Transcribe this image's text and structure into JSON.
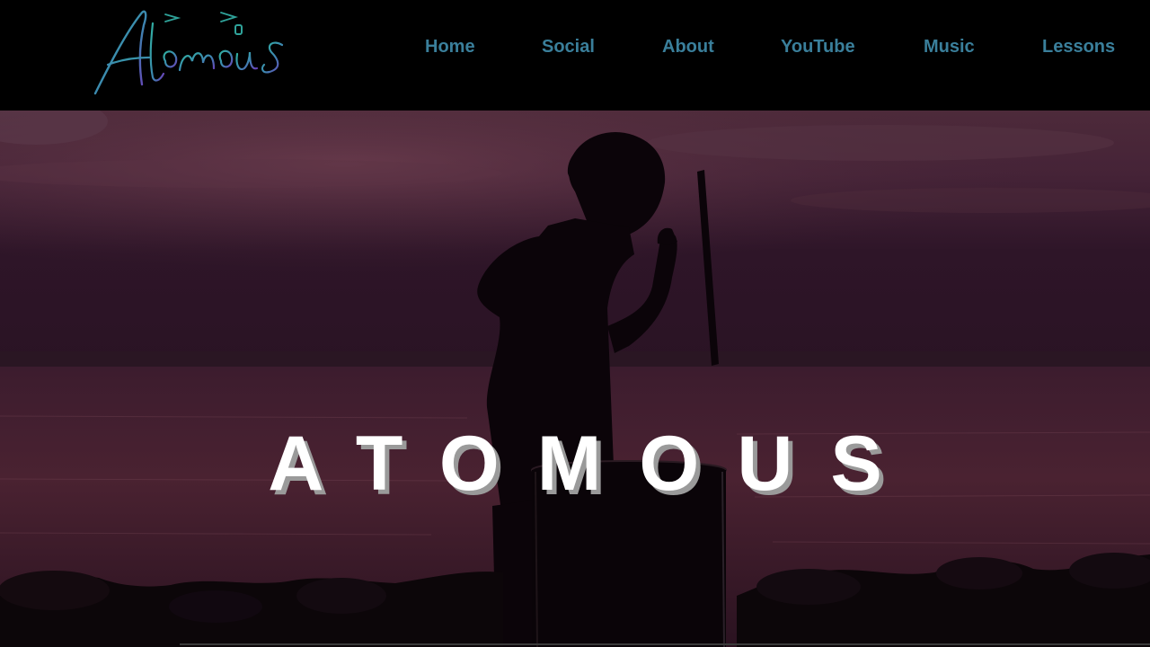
{
  "logo": {
    "text": "Atomous",
    "icon": "atomous-script-logo"
  },
  "nav": {
    "items": [
      {
        "label": "Home"
      },
      {
        "label": "Social"
      },
      {
        "label": "About"
      },
      {
        "label": "YouTube"
      },
      {
        "label": "Music"
      },
      {
        "label": "Lessons"
      }
    ]
  },
  "hero": {
    "title": "ATOMOUS",
    "image": "silhouette-drummer-at-sunset-by-water"
  },
  "colors": {
    "header_bg": "#000000",
    "nav_link": "#3a7f9b",
    "logo_gradient_start": "#2fa39a",
    "logo_gradient_end": "#6a3fb8",
    "hero_title": "#ffffff",
    "hero_title_shadow": "#9a9a9a"
  }
}
